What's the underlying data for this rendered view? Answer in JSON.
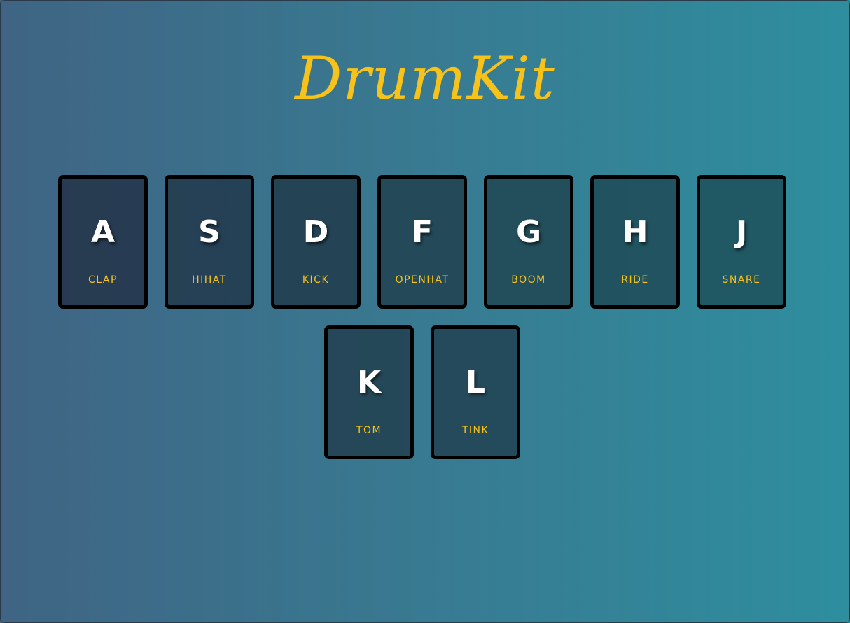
{
  "page": {
    "title": "DrumKit",
    "title_color": "#f7c21a",
    "background_gradient": [
      "#3f6484",
      "#2e8e9e"
    ]
  },
  "keys": [
    {
      "letter": "A",
      "sound": "CLAP"
    },
    {
      "letter": "S",
      "sound": "HIHAT"
    },
    {
      "letter": "D",
      "sound": "KICK"
    },
    {
      "letter": "F",
      "sound": "OPENHAT"
    },
    {
      "letter": "G",
      "sound": "BOOM"
    },
    {
      "letter": "H",
      "sound": "RIDE"
    },
    {
      "letter": "J",
      "sound": "SNARE"
    },
    {
      "letter": "K",
      "sound": "TOM"
    },
    {
      "letter": "L",
      "sound": "TINK"
    }
  ]
}
